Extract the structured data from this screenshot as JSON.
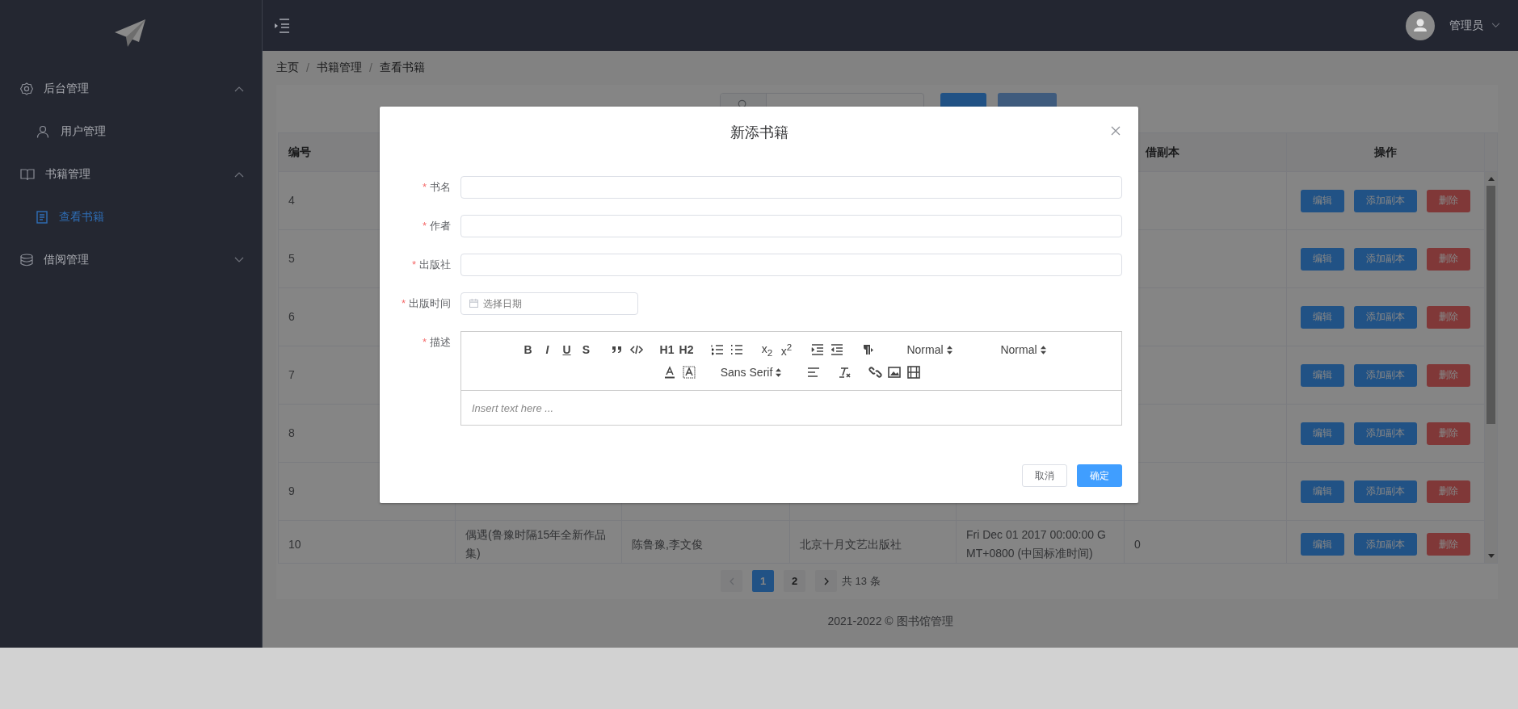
{
  "sidebar": {
    "menu": [
      {
        "label": "后台管理",
        "kind": "gear",
        "expanded": true,
        "children": [
          {
            "label": "用户管理",
            "kind": "user",
            "selected": false
          }
        ]
      },
      {
        "label": "书籍管理",
        "kind": "book",
        "expanded": true,
        "children": [
          {
            "label": "查看书籍",
            "kind": "document",
            "selected": true
          }
        ]
      },
      {
        "label": "借阅管理",
        "kind": "database",
        "expanded": false
      }
    ]
  },
  "header": {
    "user": "管理员"
  },
  "breadcrumb": {
    "separator": "/",
    "items": [
      "主页",
      "书籍管理",
      "查看书籍"
    ]
  },
  "search": {
    "buttons": [
      {
        "kind": "primary"
      },
      {
        "kind": "light"
      }
    ]
  },
  "table": {
    "columns": [
      "编号",
      "借副本",
      "操作"
    ],
    "rows": [
      {
        "id": "4",
        "actions": [
          {
            "label": "编辑",
            "kind": "primary"
          },
          {
            "label": "添加副本",
            "kind": "primary"
          },
          {
            "label": "删除",
            "kind": "danger"
          }
        ]
      },
      {
        "id": "5",
        "actions": [
          {
            "label": "编辑",
            "kind": "primary"
          },
          {
            "label": "添加副本",
            "kind": "primary"
          },
          {
            "label": "删除",
            "kind": "danger"
          }
        ]
      },
      {
        "id": "6",
        "actions": [
          {
            "label": "编辑",
            "kind": "primary"
          },
          {
            "label": "添加副本",
            "kind": "primary"
          },
          {
            "label": "删除",
            "kind": "danger"
          }
        ]
      },
      {
        "id": "7",
        "actions": [
          {
            "label": "编辑",
            "kind": "primary"
          },
          {
            "label": "添加副本",
            "kind": "primary"
          },
          {
            "label": "删除",
            "kind": "danger"
          }
        ]
      },
      {
        "id": "8",
        "actions": [
          {
            "label": "编辑",
            "kind": "primary"
          },
          {
            "label": "添加副本",
            "kind": "primary"
          },
          {
            "label": "删除",
            "kind": "danger"
          }
        ]
      },
      {
        "id": "9",
        "actions": [
          {
            "label": "编辑",
            "kind": "primary"
          },
          {
            "label": "添加副本",
            "kind": "primary"
          },
          {
            "label": "删除",
            "kind": "danger"
          }
        ]
      },
      {
        "id": "10",
        "cells": [
          "偶遇(鲁豫时隔15年全新作品集)",
          "陈鲁豫,李文俊",
          "北京十月文艺出版社",
          "Fri Dec 01 2017 00:00:00 GMT+0800 (中国标准时间)",
          "0"
        ],
        "actions": [
          {
            "label": "编辑",
            "kind": "primary"
          },
          {
            "label": "添加副本",
            "kind": "primary"
          },
          {
            "label": "删除",
            "kind": "danger"
          }
        ]
      }
    ]
  },
  "pagination": {
    "prev_disabled": true,
    "next_disabled": false,
    "pages": [
      {
        "label": "1",
        "selected": true
      },
      {
        "label": "2",
        "selected": false
      }
    ],
    "total": "共 13 条"
  },
  "footer": "2021-2022 © 图书馆管理",
  "dialog": {
    "title": "新添书籍",
    "fields": [
      {
        "label": "书名",
        "required_mark": "*",
        "kind": "text"
      },
      {
        "label": "作者",
        "required_mark": "*",
        "kind": "text"
      },
      {
        "label": "出版社",
        "required_mark": "*",
        "kind": "text"
      },
      {
        "label": "出版时间",
        "required_mark": "*",
        "kind": "date",
        "placeholder": "选择日期"
      },
      {
        "label": "描述",
        "required_mark": "*",
        "kind": "editor",
        "placeholder": "Insert text here ..."
      }
    ],
    "toolbar": [
      [
        [
          {
            "kind": "text",
            "text": "B"
          },
          {
            "kind": "text",
            "text": "I"
          },
          {
            "kind": "text",
            "text": "U"
          },
          {
            "kind": "text",
            "text": "S"
          }
        ],
        [
          {
            "kind": "quote"
          },
          {
            "kind": "code"
          }
        ],
        [
          {
            "kind": "text",
            "text": "H1"
          },
          {
            "kind": "text",
            "text": "H2"
          }
        ],
        [
          {
            "kind": "ordered"
          },
          {
            "kind": "bullet"
          }
        ],
        [
          {
            "kind": "text",
            "text": "x$_{2}$"
          },
          {
            "kind": "text",
            "text": "x$^{2}$"
          }
        ],
        [
          {
            "kind": "indent"
          },
          {
            "kind": "outdent"
          }
        ],
        [
          {
            "kind": "rtl"
          }
        ],
        [
          {
            "kind": "picker",
            "text": "Normal"
          }
        ],
        [
          {
            "kind": "picker",
            "text": "Normal"
          }
        ]
      ],
      [
        [
          {
            "kind": "color"
          },
          {
            "kind": "background"
          }
        ],
        [
          {
            "kind": "picker",
            "text": "Sans Serif"
          }
        ],
        [
          {
            "kind": "align"
          }
        ],
        [
          {
            "kind": "clean"
          }
        ],
        [
          {
            "kind": "link"
          },
          {
            "kind": "image"
          },
          {
            "kind": "video"
          }
        ]
      ]
    ],
    "buttons": [
      {
        "label": "取消",
        "kind": "default"
      },
      {
        "label": "确定",
        "kind": "primary"
      }
    ]
  }
}
